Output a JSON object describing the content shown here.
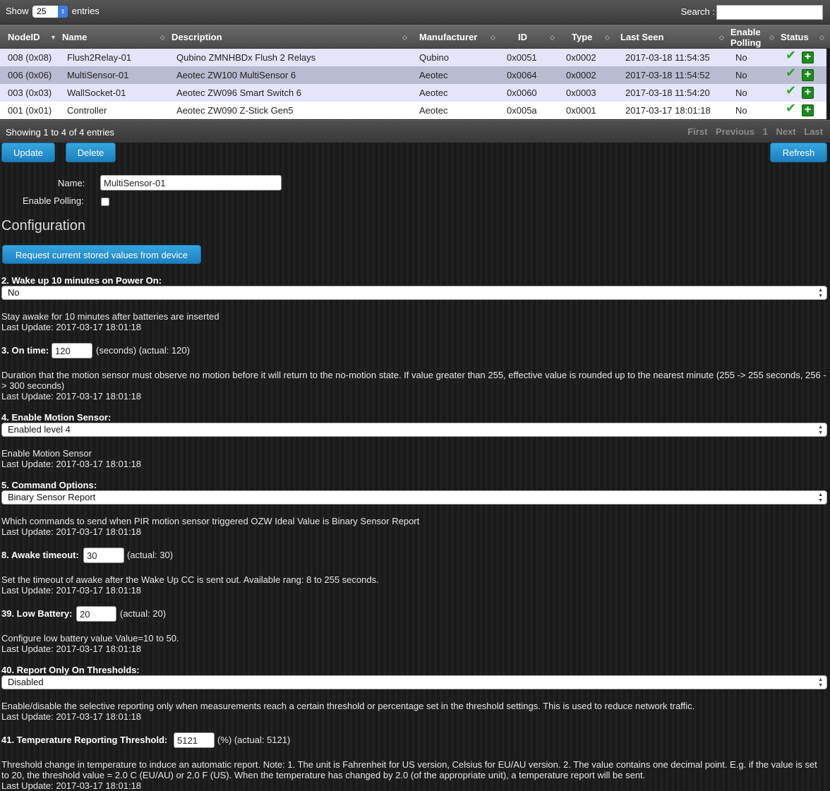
{
  "table": {
    "show_label": "Show",
    "length_value": "25",
    "entries_label": "entries",
    "search_label": "Search :",
    "columns": [
      "NodeID",
      "Name",
      "Description",
      "Manufacturer",
      "ID",
      "Type",
      "Last Seen",
      "Enable",
      "Polling",
      "Status"
    ],
    "rows": [
      {
        "nodeid": "008 (0x08)",
        "name": "Flush2Relay-01",
        "description": "Qubino ZMNHBDx Flush 2 Relays",
        "manufacturer": "Qubino",
        "id": "0x0051",
        "type": "0x0002",
        "last_seen": "2017-03-18 11:54:35",
        "polling": "No"
      },
      {
        "nodeid": "006 (0x06)",
        "name": "MultiSensor-01",
        "description": "Aeotec ZW100 MultiSensor 6",
        "manufacturer": "Aeotec",
        "id": "0x0064",
        "type": "0x0002",
        "last_seen": "2017-03-18 11:54:52",
        "polling": "No"
      },
      {
        "nodeid": "003 (0x03)",
        "name": "WallSocket-01",
        "description": "Aeotec ZW096 Smart Switch 6",
        "manufacturer": "Aeotec",
        "id": "0x0060",
        "type": "0x0003",
        "last_seen": "2017-03-18 11:54:20",
        "polling": "No"
      },
      {
        "nodeid": "001 (0x01)",
        "name": "Controller",
        "description": "Aeotec ZW090 Z-Stick Gen5",
        "manufacturer": "Aeotec",
        "id": "0x005a",
        "type": "0x0001",
        "last_seen": "2017-03-17 18:01:18",
        "polling": "No"
      }
    ],
    "info": "Showing 1 to 4 of 4 entries",
    "pager": {
      "first": "First",
      "previous": "Previous",
      "page": "1",
      "next": "Next",
      "last": "Last"
    }
  },
  "actions": {
    "update": "Update",
    "delete": "Delete",
    "refresh": "Refresh"
  },
  "form": {
    "name_label": "Name:",
    "name_value": "MultiSensor-01",
    "polling_label": "Enable Polling:"
  },
  "config": {
    "heading": "Configuration",
    "request_button": "Request current stored values from device",
    "p2": {
      "label": "2. Wake up 10 minutes on Power On:",
      "value": "No",
      "desc": "Stay awake for 10 minutes after batteries are inserted",
      "updated": "Last Update: 2017-03-17 18:01:18"
    },
    "p3": {
      "label": "3. On time:",
      "value": "120",
      "suffix": "(seconds) (actual: 120)",
      "desc": "Duration that the motion sensor must observe no motion before it will return to the no-motion state. If value greater than 255, effective value is rounded up to the nearest minute (255 -> 255 seconds, 256 -> 300 seconds)",
      "updated": "Last Update: 2017-03-17 18:01:18"
    },
    "p4": {
      "label": "4. Enable Motion Sensor:",
      "value": "Enabled level 4",
      "desc": "Enable Motion Sensor",
      "updated": "Last Update: 2017-03-17 18:01:18"
    },
    "p5": {
      "label": "5. Command Options:",
      "value": "Binary Sensor Report",
      "desc": "Which commands to send when PIR motion sensor triggered OZW Ideal Value is Binary Sensor Report",
      "updated": "Last Update: 2017-03-17 18:01:18"
    },
    "p8": {
      "label": "8. Awake timeout:",
      "value": "30",
      "suffix": "(actual: 30)",
      "desc": "Set the timeout of awake after the Wake Up CC is sent out. Available rang: 8 to 255 seconds.",
      "updated": "Last Update: 2017-03-17 18:01:18"
    },
    "p39": {
      "label": "39. Low Battery:",
      "value": "20",
      "suffix": "(actual: 20)",
      "desc": "Configure low battery value Value=10 to 50.",
      "updated": "Last Update: 2017-03-17 18:01:18"
    },
    "p40": {
      "label": "40. Report Only On Thresholds:",
      "value": "Disabled",
      "desc": "Enable/disable the selective reporting only when measurements reach a certain threshold or percentage set in the threshold settings. This is used to reduce network traffic.",
      "updated": "Last Update: 2017-03-17 18:01:18"
    },
    "p41": {
      "label": "41. Temperature Reporting Threshold:",
      "value": "5121",
      "suffix": "(%) (actual: 5121)",
      "desc": "Threshold change in temperature to induce an automatic report. Note: 1. The unit is Fahrenheit for US version, Celsius for EU/AU version. 2. The value contains one decimal point. E.g. if the value is set to 20, the threshold value = 2.0 C (EU/AU) or 2.0 F (US). When the temperature has changed by 2.0 (of the appropriate unit), a temperature report will be sent.",
      "updated": "Last Update: 2017-03-17 18:01:18"
    }
  }
}
